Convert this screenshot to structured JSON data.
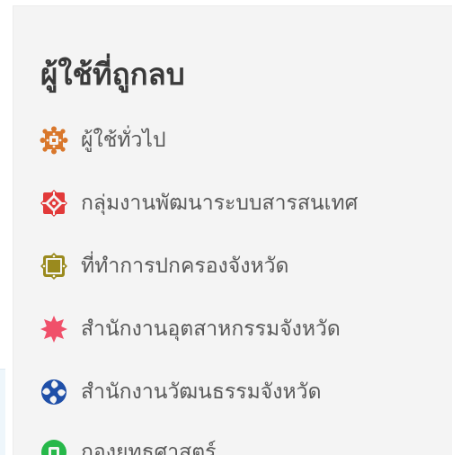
{
  "panel": {
    "title": "ผู้ใช้ที่ถูกลบ",
    "items": [
      {
        "label": "ผู้ใช้ทั่วไป",
        "icon": "pattern-icon",
        "color": "#d9772b"
      },
      {
        "label": "กลุ่มงานพัฒนาระบบสารสนเทศ",
        "icon": "pattern-icon",
        "color": "#e23a3a"
      },
      {
        "label": "ที่ทำการปกครองจังหวัด",
        "icon": "pattern-icon",
        "color": "#9a8a1e"
      },
      {
        "label": "สำนักงานอุตสาหกรรมจังหวัด",
        "icon": "pattern-icon",
        "color": "#f0506a"
      },
      {
        "label": "สำนักงานวัฒนธรรมจังหวัด",
        "icon": "pattern-icon",
        "color": "#1f4fa8"
      },
      {
        "label": "กองยุทธศาสตร์",
        "icon": "pattern-icon",
        "color": "#27b84a"
      }
    ]
  }
}
